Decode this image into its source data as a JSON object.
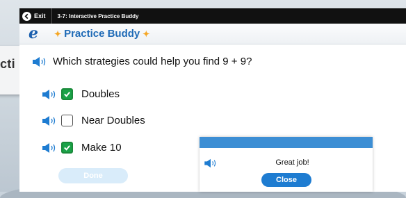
{
  "topbar": {
    "exit_label": "Exit",
    "title": "3-7: Interactive Practice Buddy"
  },
  "header": {
    "logo_letter": "e",
    "title": "Practice Buddy"
  },
  "background": {
    "partial_title": "cti"
  },
  "question": {
    "text": "Which strategies could help you find 9 + 9?"
  },
  "options": [
    {
      "label": "Doubles",
      "checked": true
    },
    {
      "label": "Near Doubles",
      "checked": false
    },
    {
      "label": "Make 10",
      "checked": true
    }
  ],
  "done_button": {
    "label": "Done",
    "state": "disabled"
  },
  "feedback": {
    "message": "Great job!",
    "close_label": "Close"
  },
  "colors": {
    "brand_blue": "#1e6ab6",
    "check_green": "#1aa248",
    "popup_header": "#3c8ed4",
    "close_button": "#1e7cd1",
    "star": "#f5a623"
  },
  "icons": [
    "arrow-left-icon",
    "speaker-icon",
    "check-icon",
    "star-icon"
  ]
}
